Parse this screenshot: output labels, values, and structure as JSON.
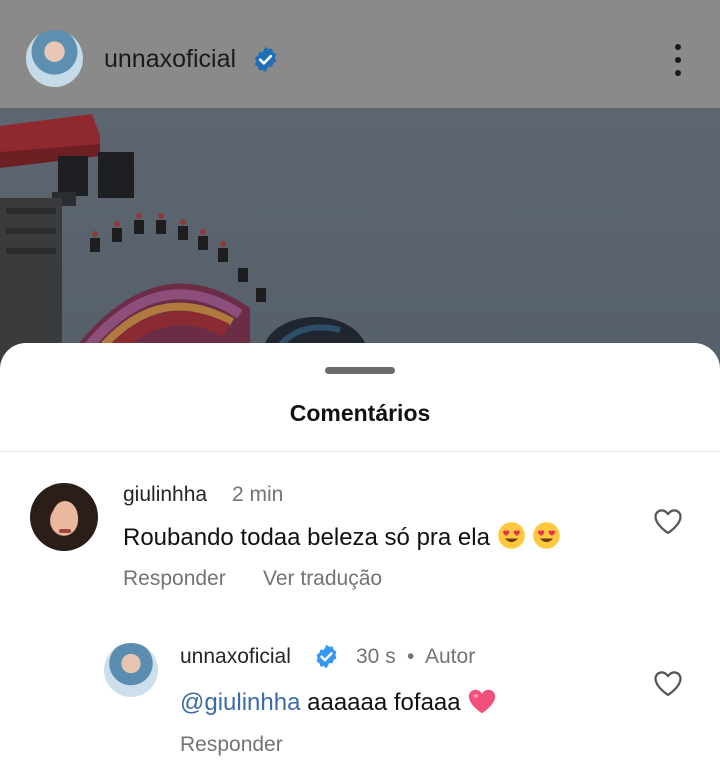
{
  "post": {
    "username": "unnaxoficial",
    "more_icon": "more-vertical-icon",
    "verified_icon": "verified-badge-icon"
  },
  "comments_sheet": {
    "title": "Comentários",
    "comments": [
      {
        "username": "giulinhha",
        "time": "2 min",
        "text": "Roubando todaa beleza só pra ela",
        "emojis": [
          "heart-eyes-emoji",
          "heart-eyes-emoji"
        ],
        "reply_label": "Responder",
        "translate_label": "Ver tradução",
        "like_icon": "heart-outline-icon"
      },
      {
        "username": "unnaxoficial",
        "verified": true,
        "time": "30 s",
        "separator": "•",
        "author_badge": "Autor",
        "mention": "@giulinhha",
        "text": "aaaaaa fofaaa",
        "emojis": [
          "pink-heart-emoji"
        ],
        "reply_label": "Responder",
        "like_icon": "heart-outline-icon"
      }
    ]
  },
  "colors": {
    "verified_blue": "#3897f0",
    "mention_blue": "#3b6aa8",
    "secondary_text": "#737373",
    "overlay_header": "#8a8a8a"
  }
}
